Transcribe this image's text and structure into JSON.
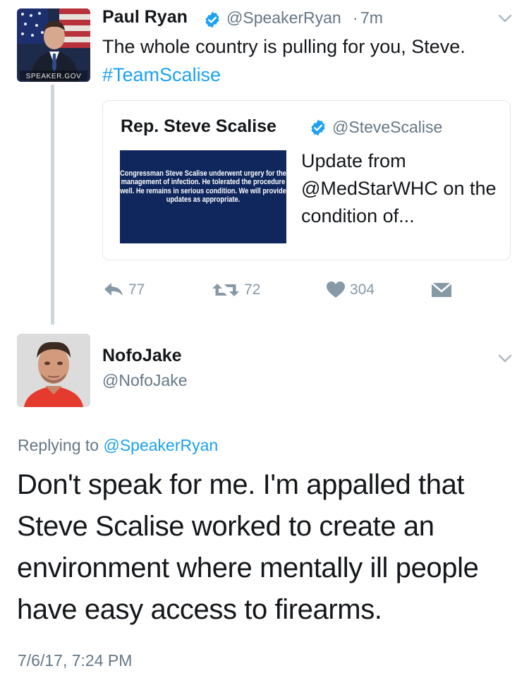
{
  "tweet": {
    "author_name": "Paul Ryan",
    "author_handle": "@SpeakerRyan",
    "separator": "·",
    "time": "7m",
    "text_before_hashtag": "The whole country is pulling for you, Steve. ",
    "hashtag": "#TeamScalise",
    "avatar_badge": "SPEAKER.GOV",
    "quoted": {
      "author_name": "Rep. Steve Scalise",
      "author_handle": "@SteveScalise",
      "image_text": "Congressman Steve Scalise underwent urgery for the management of infection. He tolerated the procedure well. He remains in serious condition. We will provide updates as appropriate.",
      "text": "Update from @MedStarWHC on the condition of..."
    },
    "actions": {
      "reply_count": "77",
      "retweet_count": "72",
      "like_count": "304"
    }
  },
  "reply": {
    "author_name": "NofoJake",
    "author_handle": "@NofoJake",
    "replying_prefix": "Replying to ",
    "replying_to": "@SpeakerRyan",
    "text": "Don't speak for me. I'm appalled that Steve Scalise worked to create an environment where mentally ill people have easy access to firearms.",
    "timestamp": "7/6/17, 7:24 PM"
  },
  "colors": {
    "link": "#1da1f2",
    "muted": "#657786",
    "verified": "#1da1f2",
    "action_icons": "#8899a6",
    "thread_line": "#ccd6dd"
  },
  "icons": [
    "verified-icon",
    "chevron-down-icon",
    "reply-icon",
    "retweet-icon",
    "heart-icon",
    "direct-message-icon"
  ]
}
